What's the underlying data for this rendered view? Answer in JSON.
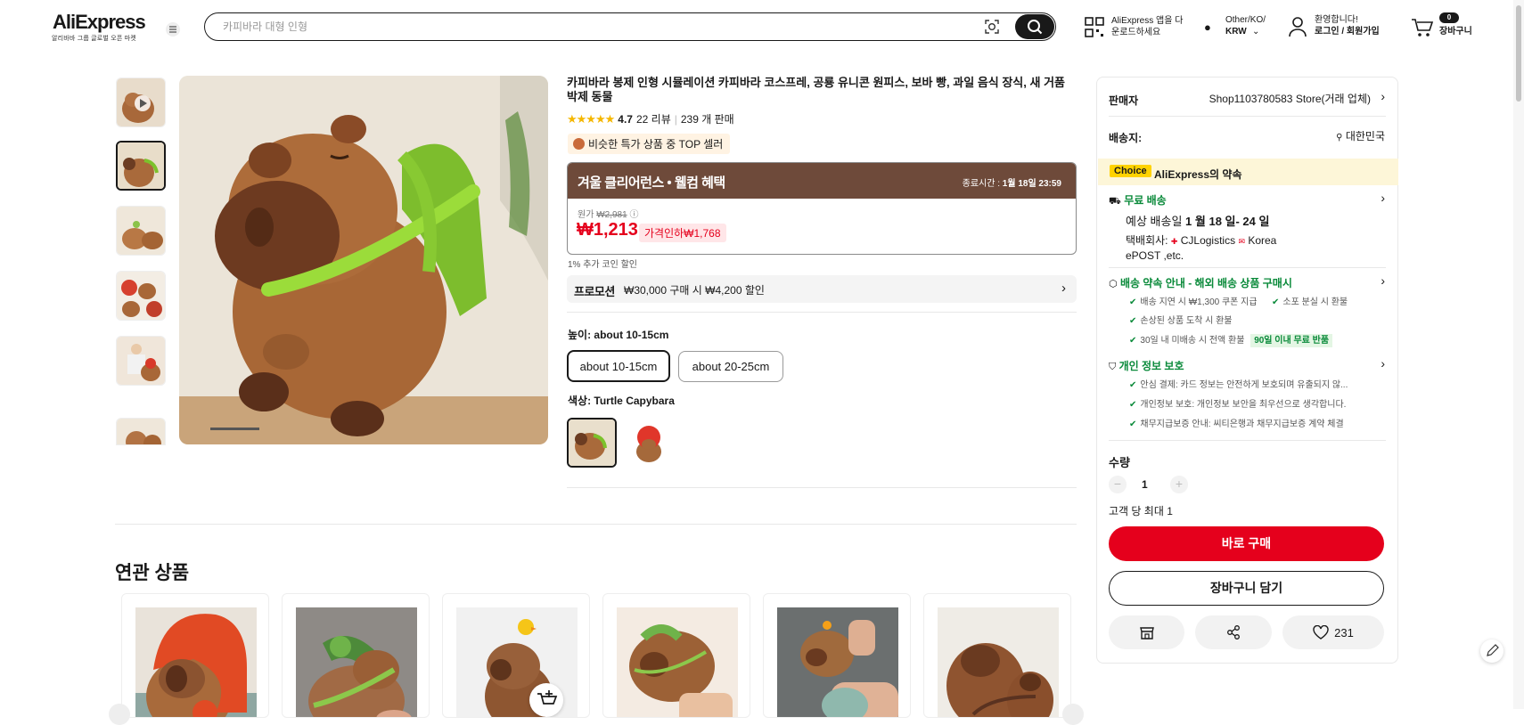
{
  "header": {
    "logo": "AliExpress",
    "logo_sub": "알리바바 그룹 글로벌 오픈 마켓",
    "search_placeholder": "카피바라 대형 인형",
    "app_line1": "AliExpress 앱을 다",
    "app_line2": "운로드하세요",
    "region_line1": "Other/KO/",
    "region_line2": "KRW",
    "user_line1": "환영합니다!",
    "user_line2": "로그인 / 회원가입",
    "cart_count": "0",
    "cart_label": "장바구니"
  },
  "product": {
    "title": "카피바라 봉제 인형 시뮬레이션 카피바라 코스프레, 공룡 유니콘 원피스, 보바 빵, 과일 음식 장식, 새 거품 박제 동물",
    "rating": "4.7",
    "reviews": "22 리뷰",
    "sold": "239 개 판매",
    "top_badge": "비슷한 특가 상품 중 TOP 셀러",
    "promo_title": "겨울 클리어런스 • 웰컴 혜택",
    "end_label": "종료시간 :",
    "end_time": "1월 18일 23:59",
    "orig_label": "원가",
    "orig_price": "₩2,981",
    "price": "₩1,213",
    "discount": "가격인하₩1,768",
    "coin": "1% 추가 코인 할인",
    "promotion_label": "프로모션",
    "promotion_text": "₩30,000 구매 시 ₩4,200 할인",
    "height_label": "높이: about 10-15cm",
    "height_options": [
      "about 10-15cm",
      "about 20-25cm"
    ],
    "color_label": "색상: Turtle Capybara"
  },
  "panel": {
    "seller_label": "판매자",
    "seller_name": "Shop1103780583 Store(거래 업체)",
    "ship_to_label": "배송지:",
    "ship_to": "대한민국",
    "choice_badge": "Choice",
    "choice_text": "AliExpress의 약속",
    "free_ship": "무료 배송",
    "eta_prefix": "예상 배송일",
    "eta": "1 월 18 일- 24 일",
    "carrier_prefix": "택배회사:",
    "carrier1": "CJLogistics",
    "carrier2": "Korea",
    "carrier3": "ePOST ,etc.",
    "promise_title": "배송 약속 안내 - 해외 배송 상품 구매시",
    "promise_items": [
      "배송 지연 시 ₩1,300 쿠폰 지급",
      "소포 분실 시 환불",
      "손상된 상품 도착 시 환불",
      "30일 내 미배송 시 전액 환불"
    ],
    "promise_badge": "90일 이내 무료 반품",
    "privacy_title": "개인 정보 보호",
    "privacy_items": [
      "안심 결제: 카드 정보는 안전하게 보호되며 유출되지 않...",
      "개인정보 보호: 개인정보 보안을 최우선으로 생각합니다.",
      "채무지급보증 안내: 씨티은행과 채무지급보증 계약 체결"
    ],
    "qty_label": "수량",
    "qty": "1",
    "qty_limit": "고객 당 최대 1",
    "buy_now": "바로 구매",
    "add_cart": "장바구니 담기",
    "wish_count": "231"
  },
  "related": {
    "title": "연관 상품"
  },
  "colors": {
    "accent": "#e5001c",
    "promo_header": "#6e4a3a",
    "green": "#0a8a3a",
    "choice_bg": "#fdf6d8"
  }
}
